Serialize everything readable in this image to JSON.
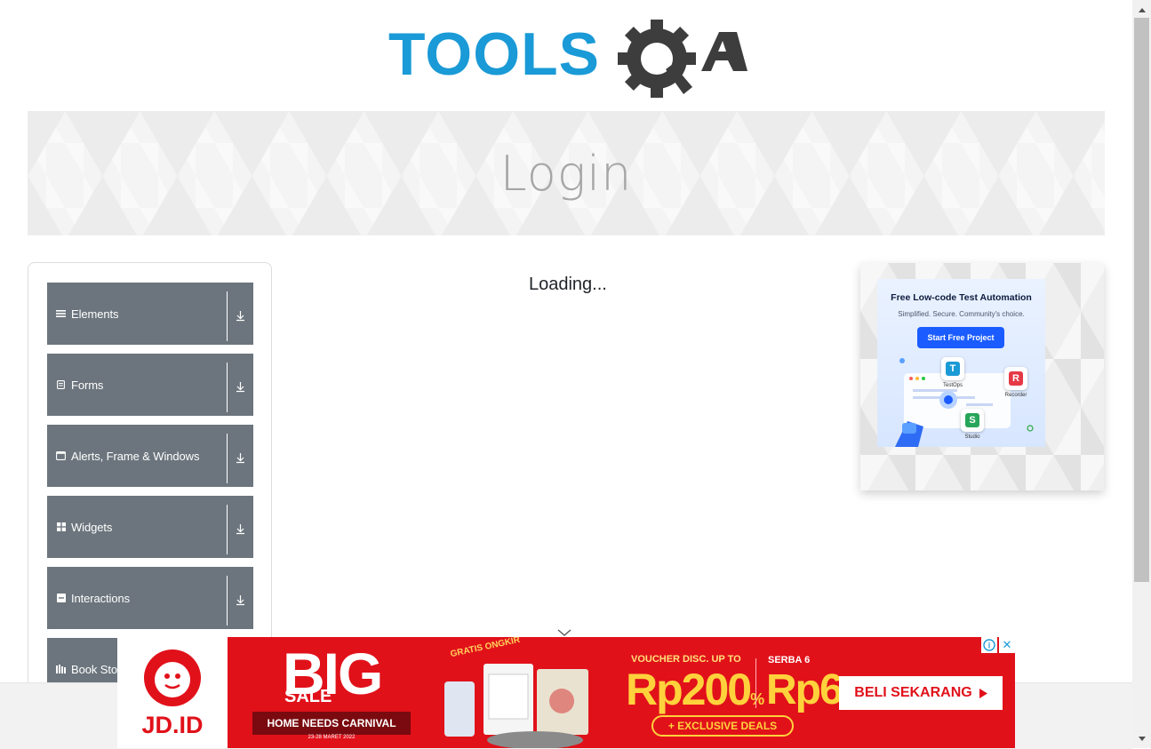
{
  "header": {
    "logo_text": "TOOLSQA"
  },
  "banner": {
    "title": "Login"
  },
  "sidebar": {
    "groups": [
      {
        "label": "Elements",
        "icon": "list-icon"
      },
      {
        "label": "Forms",
        "icon": "form-icon"
      },
      {
        "label": "Alerts, Frame & Windows",
        "icon": "window-icon"
      },
      {
        "label": "Widgets",
        "icon": "widgets-grid-icon"
      },
      {
        "label": "Interactions",
        "icon": "interactions-icon"
      },
      {
        "label": "Book Store Application",
        "icon": "book-store-icon"
      }
    ]
  },
  "main": {
    "loading_text": "Loading..."
  },
  "right_ad": {
    "title": "Free Low-code Test Automation",
    "subtitle": "Simplified. Secure. Community's choice.",
    "button": "Start Free Project",
    "products": [
      "TestOps",
      "Recorder",
      "Studio"
    ]
  },
  "bottom_ad": {
    "brand": "JD.ID",
    "headline": "BIG",
    "sale": "SALE",
    "event": "HOME NEEDS CARNIVAL",
    "event_dates": "23-28 MARET 2022",
    "gratis": "GRATIS ONGKIR",
    "voucher_label": "VOUCHER DISC. UP TO",
    "voucher_amount": "Rp200",
    "voucher_unit": "%",
    "exclusive": "+ EXCLUSIVE DEALS",
    "serba_label": "SERBA 6",
    "serba_amount": "Rp6",
    "cta": "BELI SEKARANG",
    "info_glyph": "i",
    "close_glyph": "✕"
  },
  "colors": {
    "menu_bg": "#6c757d",
    "logo_blue": "#1a9ad6",
    "logo_dark": "#3d3d3d",
    "ad_red": "#e1111a"
  }
}
